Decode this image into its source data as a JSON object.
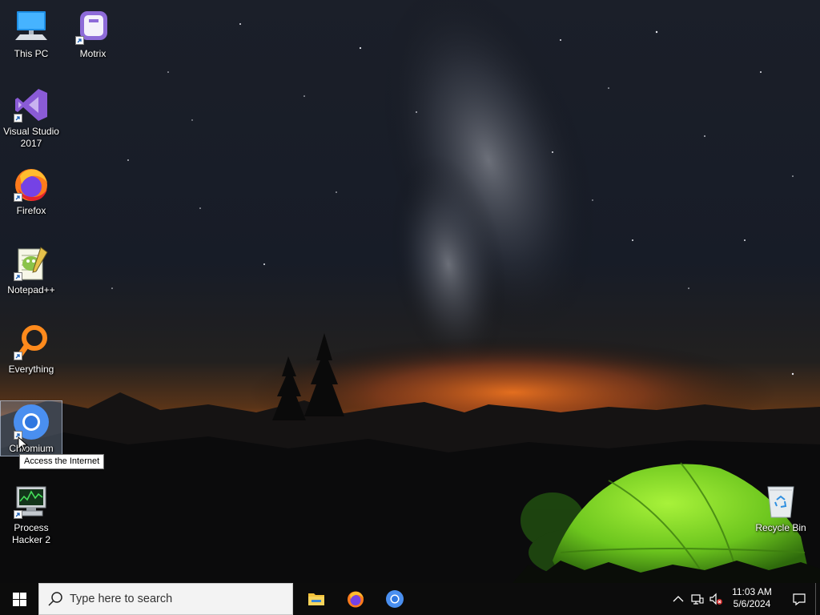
{
  "desktop": {
    "icons": [
      {
        "label": "This PC"
      },
      {
        "label": "Motrix"
      },
      {
        "label": "Visual Studio 2017"
      },
      {
        "label": "Firefox"
      },
      {
        "label": "Notepad++"
      },
      {
        "label": "Everything"
      },
      {
        "label": "Chromium"
      },
      {
        "label": "Process Hacker 2"
      },
      {
        "label": "Recycle Bin"
      }
    ],
    "tooltip": "Access the Internet"
  },
  "taskbar": {
    "search_placeholder": "Type here to search",
    "pinned_apps": [
      "file-explorer",
      "firefox",
      "chromium"
    ],
    "tray": {
      "time": "11:03 AM",
      "date": "5/6/2024"
    }
  }
}
